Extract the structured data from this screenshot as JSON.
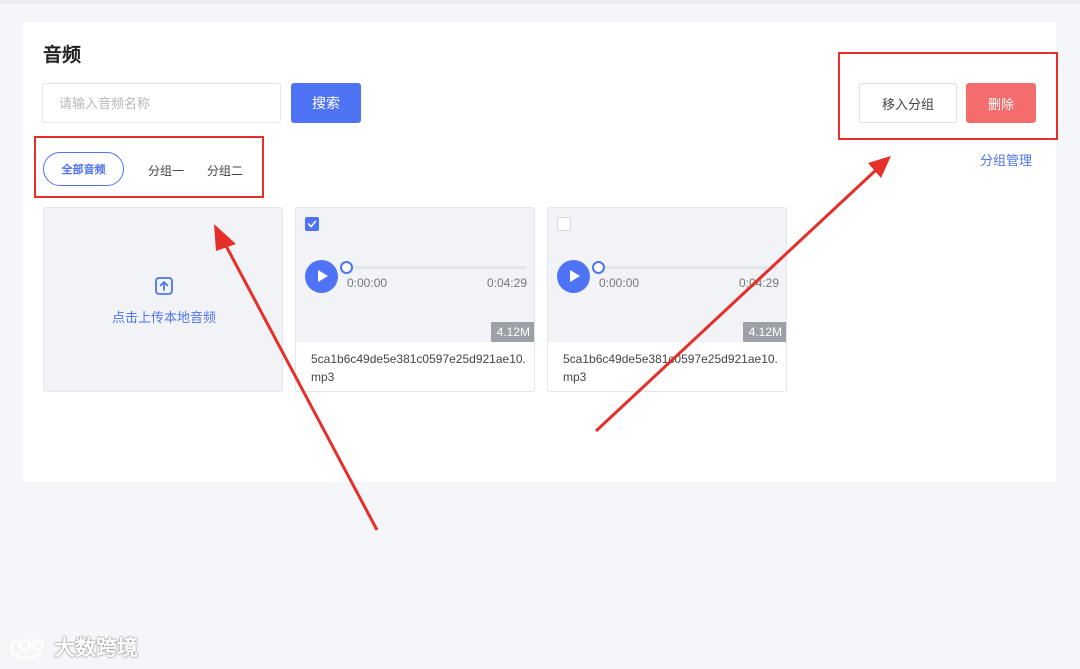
{
  "page": {
    "title": "音频"
  },
  "search": {
    "placeholder": "请输入音频名称",
    "button_label": "搜索"
  },
  "actions": {
    "move_label": "移入分组",
    "delete_label": "删除",
    "manage_label": "分组管理"
  },
  "tabs": [
    {
      "label": "全部音频",
      "active": true
    },
    {
      "label": "分组一",
      "active": false
    },
    {
      "label": "分组二",
      "active": false
    }
  ],
  "upload": {
    "label": "点击上传本地音频",
    "icon": "upload-icon"
  },
  "audios": [
    {
      "checked": true,
      "current_time": "0:00:00",
      "duration": "0:04:29",
      "size": "4.12M",
      "filename": "5ca1b6c49de5e381c0597e25d921ae10.mp3"
    },
    {
      "checked": false,
      "current_time": "0:00:00",
      "duration": "0:04:29",
      "size": "4.12M",
      "filename": "5ca1b6c49de5e381c0597e25d921ae10.mp3"
    }
  ],
  "watermark": {
    "text": "大数跨境"
  },
  "colors": {
    "primary": "#4e74f5",
    "danger": "#f56c6c",
    "annotation": "#e5302a"
  }
}
